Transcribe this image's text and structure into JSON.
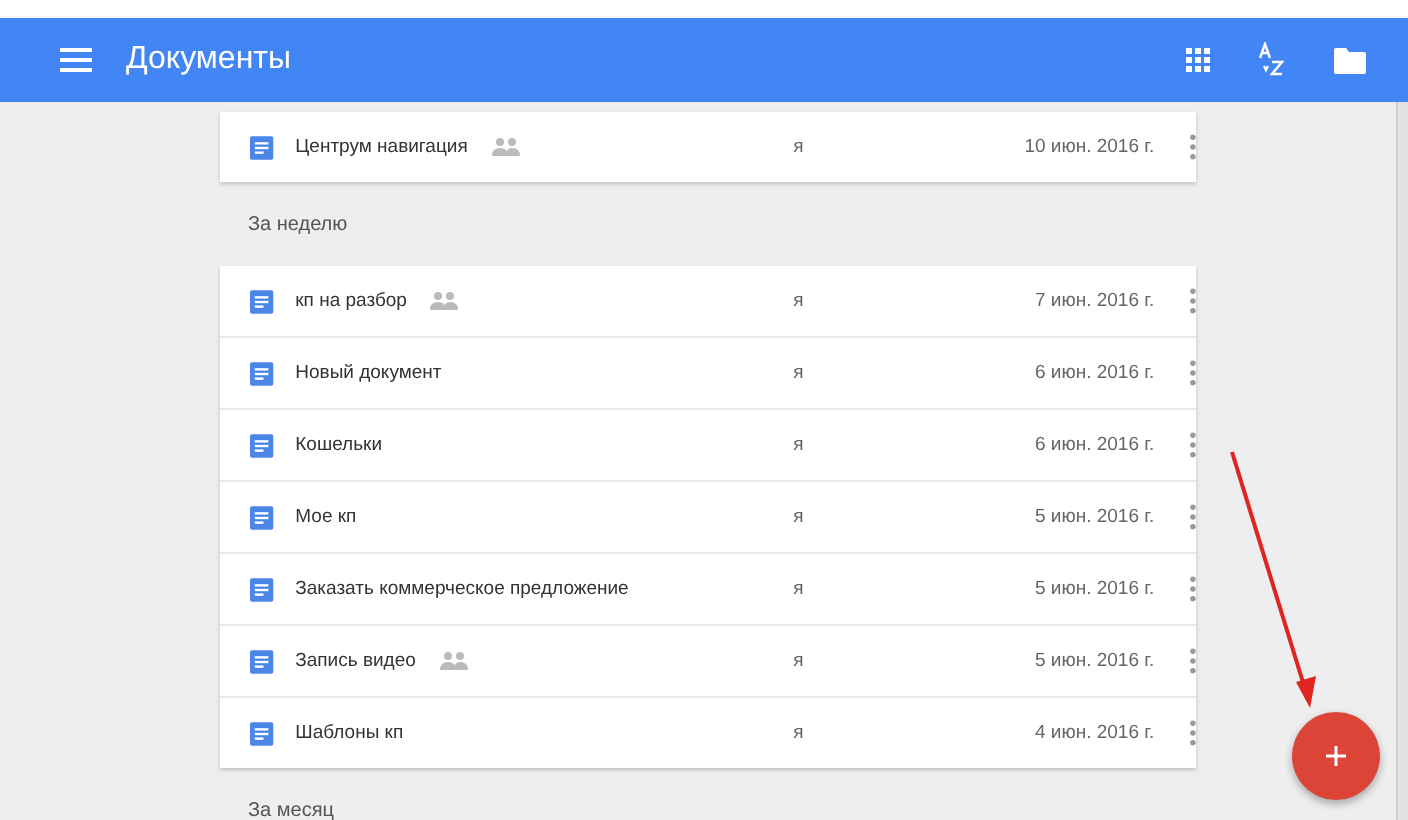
{
  "app_bar": {
    "title": "Документы"
  },
  "sections": [
    {
      "rows": [
        {
          "name": "Центрум навигация",
          "shared": true,
          "owner": "я",
          "date": "10 июн. 2016 г."
        }
      ]
    },
    {
      "label": "За неделю",
      "rows": [
        {
          "name": "кп на разбор",
          "shared": true,
          "owner": "я",
          "date": "7 июн. 2016 г."
        },
        {
          "name": "Новый документ",
          "shared": false,
          "owner": "я",
          "date": "6 июн. 2016 г."
        },
        {
          "name": "Кошельки",
          "shared": false,
          "owner": "я",
          "date": "6 июн. 2016 г."
        },
        {
          "name": "Мое кп",
          "shared": false,
          "owner": "я",
          "date": "5 июн. 2016 г."
        },
        {
          "name": "Заказать коммерческое предложение",
          "shared": false,
          "owner": "я",
          "date": "5 июн. 2016 г."
        },
        {
          "name": "Запись видео",
          "shared": true,
          "owner": "я",
          "date": "5 июн. 2016 г."
        },
        {
          "name": "Шаблоны кп",
          "shared": false,
          "owner": "я",
          "date": "4 июн. 2016 г."
        }
      ]
    },
    {
      "label": "За месяц"
    }
  ]
}
